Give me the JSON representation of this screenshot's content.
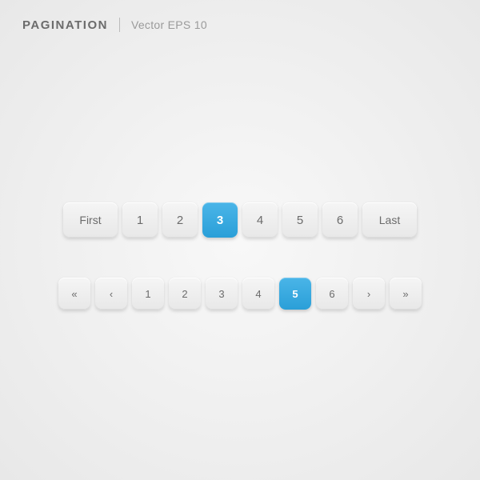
{
  "header": {
    "title": "PAGINATION",
    "subtitle": "Vector EPS 10"
  },
  "pagination1": {
    "buttons": [
      {
        "label": "First",
        "type": "wide",
        "active": false,
        "name": "first-button"
      },
      {
        "label": "1",
        "type": "square",
        "active": false,
        "name": "page-1-button"
      },
      {
        "label": "2",
        "type": "square",
        "active": false,
        "name": "page-2-button"
      },
      {
        "label": "3",
        "type": "square",
        "active": true,
        "name": "page-3-button"
      },
      {
        "label": "4",
        "type": "square",
        "active": false,
        "name": "page-4-button"
      },
      {
        "label": "5",
        "type": "square",
        "active": false,
        "name": "page-5-button"
      },
      {
        "label": "6",
        "type": "square",
        "active": false,
        "name": "page-6-button"
      },
      {
        "label": "Last",
        "type": "wide",
        "active": false,
        "name": "last-button"
      }
    ]
  },
  "pagination2": {
    "buttons": [
      {
        "label": "«",
        "type": "small",
        "active": false,
        "name": "first-nav-button"
      },
      {
        "label": "‹",
        "type": "small",
        "active": false,
        "name": "prev-button"
      },
      {
        "label": "1",
        "type": "small",
        "active": false,
        "name": "page-1-button"
      },
      {
        "label": "2",
        "type": "small",
        "active": false,
        "name": "page-2-button"
      },
      {
        "label": "3",
        "type": "small",
        "active": false,
        "name": "page-3-button"
      },
      {
        "label": "4",
        "type": "small",
        "active": false,
        "name": "page-4-button"
      },
      {
        "label": "5",
        "type": "small",
        "active": true,
        "name": "page-5-button"
      },
      {
        "label": "6",
        "type": "small",
        "active": false,
        "name": "page-6-button"
      },
      {
        "label": "›",
        "type": "small",
        "active": false,
        "name": "next-button"
      },
      {
        "label": "»",
        "type": "small",
        "active": false,
        "name": "last-nav-button"
      }
    ]
  }
}
